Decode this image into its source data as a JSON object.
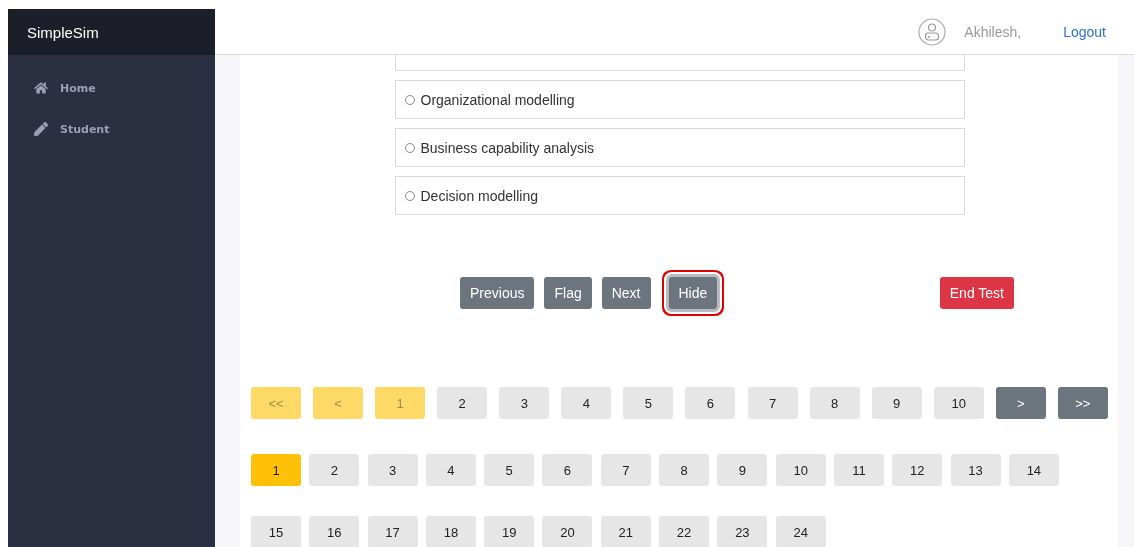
{
  "brand": "SimpleSim",
  "sidebar": {
    "items": [
      {
        "label": "Home",
        "kind": "home"
      },
      {
        "label": "Student",
        "kind": "edit"
      }
    ]
  },
  "header": {
    "user": "Akhilesh,",
    "logout": "Logout"
  },
  "options": [
    {
      "label": "Organizational modelling",
      "selected": false
    },
    {
      "label": "Business capability analysis",
      "selected": false
    },
    {
      "label": "Decision modelling",
      "selected": false
    }
  ],
  "actions": [
    {
      "label": "Previous",
      "kind": "secondary",
      "highlighted": false
    },
    {
      "label": "Flag",
      "kind": "secondary",
      "highlighted": false
    },
    {
      "label": "Next",
      "kind": "secondary",
      "highlighted": false
    },
    {
      "label": "Hide",
      "kind": "secondary",
      "highlighted": true
    },
    {
      "label": "End Test",
      "kind": "danger",
      "highlighted": false
    }
  ],
  "pager": [
    {
      "label": "<<",
      "kind": "nav",
      "disabled": true
    },
    {
      "label": "<",
      "kind": "nav",
      "disabled": true
    },
    {
      "label": "1",
      "kind": "page",
      "selected": true
    },
    {
      "label": "2",
      "kind": "page",
      "selected": false
    },
    {
      "label": "3",
      "kind": "page",
      "selected": false
    },
    {
      "label": "4",
      "kind": "page",
      "selected": false
    },
    {
      "label": "5",
      "kind": "page",
      "selected": false
    },
    {
      "label": "6",
      "kind": "page",
      "selected": false
    },
    {
      "label": "7",
      "kind": "page",
      "selected": false
    },
    {
      "label": "8",
      "kind": "page",
      "selected": false
    },
    {
      "label": "9",
      "kind": "page",
      "selected": false
    },
    {
      "label": "10",
      "kind": "page",
      "selected": false
    },
    {
      "label": ">",
      "kind": "nav",
      "disabled": false
    },
    {
      "label": ">>",
      "kind": "nav",
      "disabled": false
    }
  ],
  "questions": [
    {
      "label": "1",
      "selected": true
    },
    {
      "label": "2",
      "selected": false
    },
    {
      "label": "3",
      "selected": false
    },
    {
      "label": "4",
      "selected": false
    },
    {
      "label": "5",
      "selected": false
    },
    {
      "label": "6",
      "selected": false
    },
    {
      "label": "7",
      "selected": false
    },
    {
      "label": "8",
      "selected": false
    },
    {
      "label": "9",
      "selected": false
    },
    {
      "label": "10",
      "selected": false
    },
    {
      "label": "11",
      "selected": false
    },
    {
      "label": "12",
      "selected": false
    },
    {
      "label": "13",
      "selected": false
    },
    {
      "label": "14",
      "selected": false
    },
    {
      "label": "15",
      "selected": false
    },
    {
      "label": "16",
      "selected": false
    },
    {
      "label": "17",
      "selected": false
    },
    {
      "label": "18",
      "selected": false
    },
    {
      "label": "19",
      "selected": false
    },
    {
      "label": "20",
      "selected": false
    },
    {
      "label": "21",
      "selected": false
    },
    {
      "label": "22",
      "selected": false
    },
    {
      "label": "23",
      "selected": false
    },
    {
      "label": "24",
      "selected": false
    }
  ]
}
